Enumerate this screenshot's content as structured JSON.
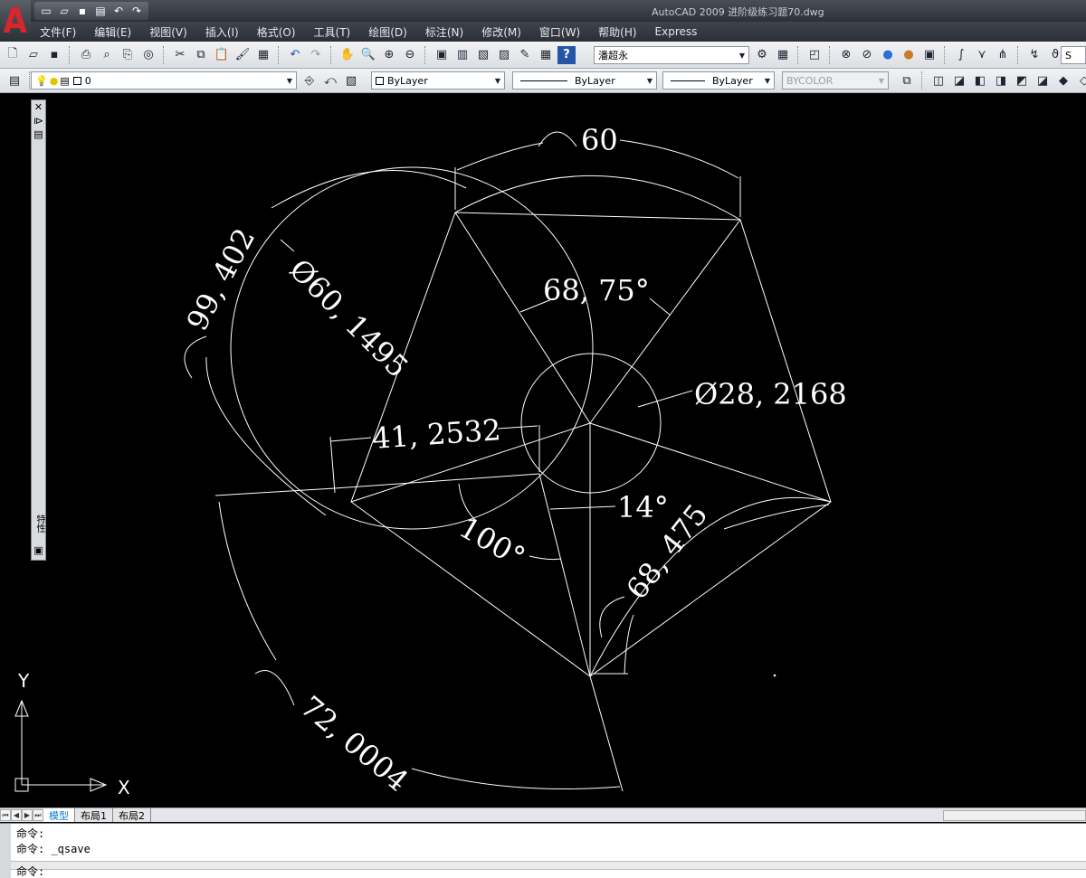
{
  "window": {
    "title": "AutoCAD 2009  进阶级练习题70.dwg",
    "logo_letter": "A"
  },
  "menus": [
    "文件(F)",
    "编辑(E)",
    "视图(V)",
    "插入(I)",
    "格式(O)",
    "工具(T)",
    "绘图(D)",
    "标注(N)",
    "修改(M)",
    "窗口(W)",
    "帮助(H)",
    "Express"
  ],
  "toolbar": {
    "textstyle_value": "潘超永",
    "layer_value": "0",
    "color_value": "ByLayer",
    "linetype_value": "ByLayer",
    "lineweight_value": "ByLayer",
    "plotstyle_value": "BYCOLOR",
    "overflow_value": "S"
  },
  "palette": {
    "label": "特性"
  },
  "drawing": {
    "dimensions": {
      "d_60": "60",
      "d_99402": "99, 402",
      "d_dia601495": "Ø60, 1495",
      "d_6875": "68, 75°",
      "d_dia282168": "Ø28, 2168",
      "d_412532": "41, 2532",
      "d_14": "14°",
      "d_100": "100°",
      "d_68475": "68, 475",
      "d_720004": "72, 0004"
    },
    "ucs": {
      "x_label": "X",
      "y_label": "Y"
    },
    "background_color": "#000000",
    "line_color": "#ffffff"
  },
  "layout_tabs": [
    "模型",
    "布局1",
    "布局2"
  ],
  "command": {
    "history": [
      "命令:",
      "命令: _qsave"
    ],
    "prompt": "命令:"
  }
}
